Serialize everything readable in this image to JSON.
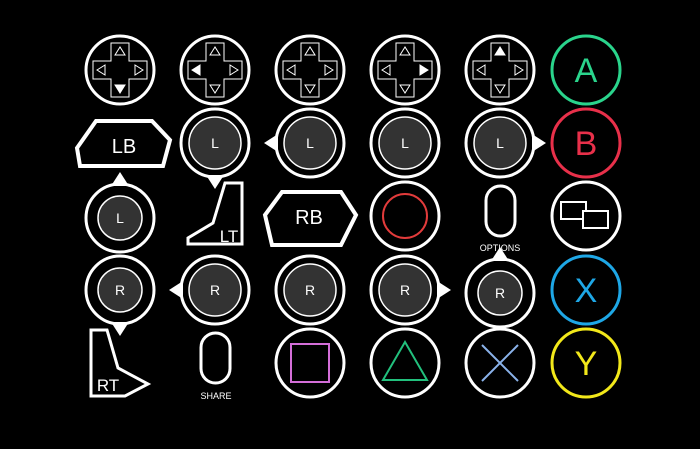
{
  "colors": {
    "background": "#000000",
    "outline": "#ffffff",
    "stick_fill": "#333333",
    "a_button": "#2ad48c",
    "b_button": "#e8304a",
    "x_button": "#1ea7e6",
    "y_button": "#f2e81a",
    "ps_circle": "#e23b3b",
    "ps_square": "#d46ed9",
    "ps_triangle": "#22c07d",
    "ps_cross": "#8ab2ea"
  },
  "icons": {
    "dpad_down": {
      "name": "dpad-down-icon",
      "pressed": "down"
    },
    "dpad_left": {
      "name": "dpad-left-icon",
      "pressed": "left"
    },
    "dpad_neutral": {
      "name": "dpad-neutral-icon",
      "pressed": "none"
    },
    "dpad_right": {
      "name": "dpad-right-icon",
      "pressed": "right"
    },
    "dpad_up": {
      "name": "dpad-up-icon",
      "pressed": "up"
    },
    "lb": {
      "name": "left-bumper-icon",
      "label": "LB"
    },
    "rb": {
      "name": "right-bumper-icon",
      "label": "RB"
    },
    "lt": {
      "name": "left-trigger-icon",
      "label": "LT"
    },
    "rt": {
      "name": "right-trigger-icon",
      "label": "RT"
    },
    "l_stick_label": "L",
    "r_stick_label": "R",
    "a": {
      "name": "a-button-icon",
      "label": "A"
    },
    "b": {
      "name": "b-button-icon",
      "label": "B"
    },
    "x": {
      "name": "x-button-icon",
      "label": "X"
    },
    "y": {
      "name": "y-button-icon",
      "label": "Y"
    },
    "view": {
      "name": "view-button-icon"
    },
    "options": {
      "name": "options-button-icon",
      "label": "OPTIONS"
    },
    "share": {
      "name": "share-button-icon",
      "label": "SHARE"
    },
    "ps_circle": {
      "name": "playstation-circle-icon"
    },
    "ps_square": {
      "name": "playstation-square-icon"
    },
    "ps_triangle": {
      "name": "playstation-triangle-icon"
    },
    "ps_cross": {
      "name": "playstation-cross-icon"
    }
  }
}
